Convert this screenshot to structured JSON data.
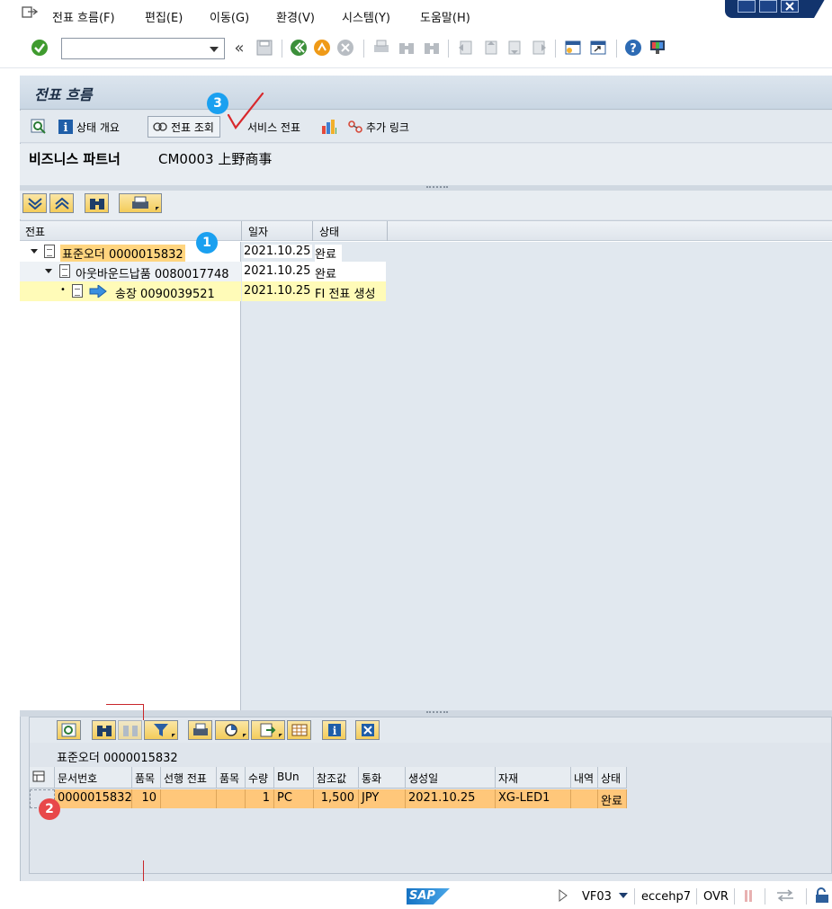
{
  "menu": {
    "items": [
      "전표 흐름(F)",
      "편집(E)",
      "이동(G)",
      "환경(V)",
      "시스템(Y)",
      "도움말(H)"
    ]
  },
  "toolbar": {
    "command_value": "",
    "back_symbol": "«"
  },
  "page": {
    "title": "전표 흐름"
  },
  "app_toolbar": {
    "status_overview": "상태 개요",
    "display_document": "전표 조회",
    "service_documents": "서비스 전표",
    "additional_links": "추가 링크"
  },
  "partner": {
    "label": "비즈니스 파트너",
    "value": "CM0003 上野商事"
  },
  "tree": {
    "columns": [
      "전표",
      "일자",
      "상태"
    ],
    "rows": [
      {
        "doc": "표준오더 0000015832",
        "date": "2021.10.25",
        "status": "완료"
      },
      {
        "doc": "아웃바운드납품 0080017748",
        "date": "2021.10.25",
        "status": "완료"
      },
      {
        "doc": "송장 0090039521",
        "date": "2021.10.25",
        "status": "FI 전표 생성"
      }
    ]
  },
  "lower": {
    "title": "표준오더 0000015832",
    "columns": [
      "문서번호",
      "품목",
      "선행 전표",
      "품목",
      "수량",
      "BUn",
      "참조값",
      "통화",
      "생성일",
      "자재",
      "내역",
      "상태"
    ],
    "rows": [
      {
        "doc_no": "0000015832",
        "item": "10",
        "preceding_doc": "",
        "prec_item": "",
        "qty": "1",
        "bun": "PC",
        "ref_value": "1,500",
        "currency": "JPY",
        "created": "2021.10.25",
        "material": "XG-LED1",
        "desc": "",
        "status": "완료"
      }
    ]
  },
  "annotations": {
    "badge1": "1",
    "badge2": "2",
    "badge3": "3"
  },
  "statusbar": {
    "logo": "SAP",
    "transaction": "VF03",
    "server": "eccehp7",
    "mode": "OVR"
  },
  "colors": {
    "selected_row": "#ffc77a",
    "highlight_orange": "#ffd57f",
    "highlight_yellow": "#fffbb8",
    "badge_blue": "#1aa0f0",
    "badge_red": "#e8484a",
    "annotation_red": "#c9262a"
  },
  "icons": [
    "exit-icon",
    "check-icon",
    "save-icon",
    "back-icon",
    "exit-circle-icon",
    "cancel-icon",
    "print-icon",
    "find-icon",
    "find-next-icon",
    "first-page-icon",
    "prev-page-icon",
    "next-page-icon",
    "last-page-icon",
    "new-session-icon",
    "shortcut-icon",
    "help-icon",
    "customize-icon",
    "zoom-icon",
    "info-icon",
    "display-icon",
    "chart-icon",
    "link-icon",
    "expand-all-icon",
    "collapse-all-icon",
    "binoculars-icon",
    "printer-icon",
    "filter-icon",
    "layout-icon",
    "export-icon",
    "detail-icon",
    "close-icon",
    "lock-icon"
  ]
}
